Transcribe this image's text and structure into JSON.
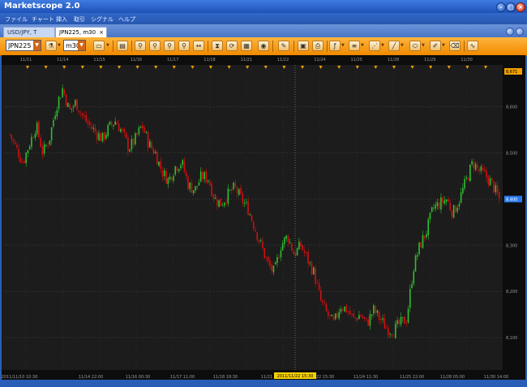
{
  "window": {
    "title": "Marketscope 2.0"
  },
  "menu": [
    {
      "label": "ファイル"
    },
    {
      "label": "チャート"
    },
    {
      "label": "挿入"
    },
    {
      "label": "取引"
    },
    {
      "label": "シグナル"
    },
    {
      "label": "ヘルプ"
    }
  ],
  "tabs": [
    {
      "label": "USD/JPY, T"
    },
    {
      "label": "JPN225, m30"
    }
  ],
  "toolbar": {
    "instrument": "JPN225",
    "timeframe": "m30"
  },
  "chart_data": {
    "type": "candlestick",
    "instrument": "JPN225",
    "timeframe": "m30",
    "top_date_labels": [
      "11/11",
      "11/14",
      "11/15",
      "11/16",
      "11/17",
      "11/18",
      "11/21",
      "11/22",
      "11/24",
      "11/25",
      "11/28",
      "11/29",
      "11/30"
    ],
    "bottom_time_labels": [
      "2011/11/10 10:30",
      "11/14 22:00",
      "11/16 00:30",
      "11/17 11:00",
      "11/18 18:30",
      "11/21 11:30",
      "11/22 15:30",
      "11/24 11:30",
      "11/25 22:00",
      "11/28 05:00",
      "11/30 14:00"
    ],
    "crosshair_label": "2011/11/22 15:30",
    "price_labels": [
      "8,600",
      "8,500",
      "8,400",
      "8,300",
      "8,200",
      "8,100"
    ],
    "price_values": [
      8600,
      8500,
      8400,
      8300,
      8200,
      8100
    ],
    "top_price_label": "8,671",
    "top_price_value": 8671,
    "last_price_label": "8,400",
    "last_price_value": 8400,
    "colors": {
      "up": "#2fbf2f",
      "down": "#d01010",
      "grid": "#3a3a3a",
      "marker": "#f0a000",
      "last_price_bg": "#2a7bf0",
      "crosshair_bg": "#f5d000"
    },
    "path": [
      [
        0,
        8540
      ],
      [
        1,
        8510
      ],
      [
        2,
        8480
      ],
      [
        3,
        8520
      ],
      [
        4,
        8560
      ],
      [
        5,
        8500
      ],
      [
        6,
        8530
      ],
      [
        7,
        8600
      ],
      [
        8,
        8640
      ],
      [
        9,
        8590
      ],
      [
        10,
        8610
      ],
      [
        11,
        8580
      ],
      [
        12,
        8560
      ],
      [
        13,
        8545
      ],
      [
        14,
        8530
      ],
      [
        15,
        8555
      ],
      [
        16,
        8570
      ],
      [
        17,
        8545
      ],
      [
        18,
        8510
      ],
      [
        19,
        8530
      ],
      [
        20,
        8560
      ],
      [
        21,
        8520
      ],
      [
        22,
        8500
      ],
      [
        23,
        8460
      ],
      [
        24,
        8440
      ],
      [
        25,
        8470
      ],
      [
        26,
        8480
      ],
      [
        27,
        8430
      ],
      [
        28,
        8420
      ],
      [
        29,
        8450
      ],
      [
        30,
        8445
      ],
      [
        31,
        8400
      ],
      [
        32,
        8390
      ],
      [
        33,
        8410
      ],
      [
        34,
        8425
      ],
      [
        35,
        8400
      ],
      [
        36,
        8380
      ],
      [
        37,
        8340
      ],
      [
        38,
        8300
      ],
      [
        39,
        8260
      ],
      [
        40,
        8240
      ],
      [
        41,
        8300
      ],
      [
        42,
        8320
      ],
      [
        43,
        8280
      ],
      [
        44,
        8300
      ],
      [
        45,
        8270
      ],
      [
        46,
        8240
      ],
      [
        47,
        8180
      ],
      [
        48,
        8150
      ],
      [
        49,
        8130
      ],
      [
        50,
        8170
      ],
      [
        51,
        8160
      ],
      [
        52,
        8140
      ],
      [
        53,
        8150
      ],
      [
        54,
        8130
      ],
      [
        55,
        8160
      ],
      [
        56,
        8140
      ],
      [
        57,
        8120
      ],
      [
        58,
        8115
      ],
      [
        59,
        8130
      ],
      [
        60,
        8140
      ],
      [
        61,
        8250
      ],
      [
        62,
        8300
      ],
      [
        63,
        8330
      ],
      [
        64,
        8380
      ],
      [
        65,
        8390
      ],
      [
        66,
        8400
      ],
      [
        67,
        8370
      ],
      [
        68,
        8400
      ],
      [
        69,
        8440
      ],
      [
        70,
        8480
      ],
      [
        71,
        8460
      ],
      [
        72,
        8450
      ],
      [
        73,
        8430
      ],
      [
        74,
        8400
      ]
    ]
  }
}
